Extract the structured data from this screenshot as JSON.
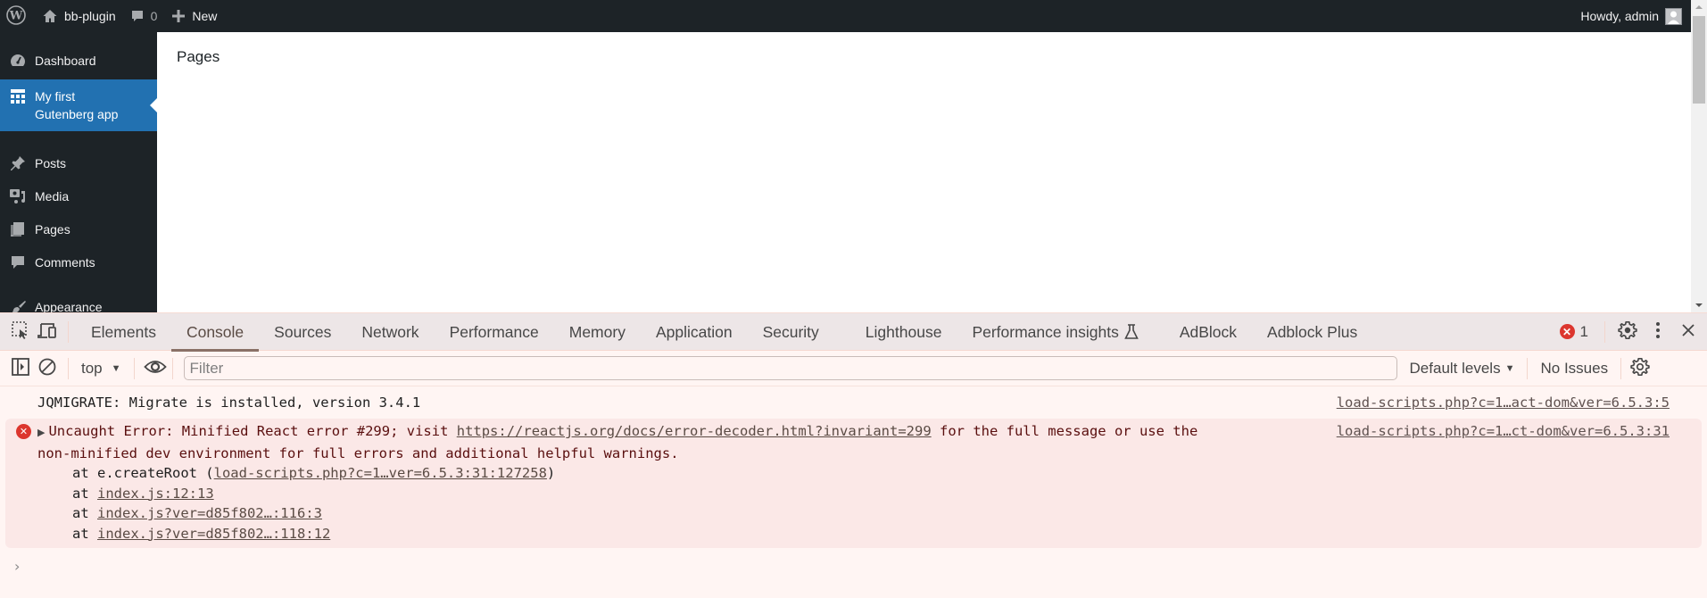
{
  "adminbar": {
    "site_name": "bb-plugin",
    "comments_count": "0",
    "new_label": "New",
    "greeting": "Howdy, admin"
  },
  "sidebar": {
    "items": [
      {
        "label": "Dashboard",
        "icon": "dashboard-icon"
      },
      {
        "label": "My first Gutenberg app",
        "icon": "table-layout-icon",
        "active": true
      },
      {
        "label": "Posts",
        "icon": "pin-icon"
      },
      {
        "label": "Media",
        "icon": "media-icon"
      },
      {
        "label": "Pages",
        "icon": "pages-icon"
      },
      {
        "label": "Comments",
        "icon": "comment-icon"
      },
      {
        "label": "Appearance",
        "icon": "paintbrush-icon"
      }
    ]
  },
  "content": {
    "heading": "Pages"
  },
  "devtools": {
    "tabs": [
      {
        "label": "Elements"
      },
      {
        "label": "Console",
        "selected": true
      },
      {
        "label": "Sources"
      },
      {
        "label": "Network"
      },
      {
        "label": "Performance"
      },
      {
        "label": "Memory"
      },
      {
        "label": "Application"
      },
      {
        "label": "Security"
      },
      {
        "label": "Lighthouse"
      },
      {
        "label": "Performance insights"
      },
      {
        "label": "AdBlock"
      },
      {
        "label": "Adblock Plus"
      }
    ],
    "error_count": "1",
    "toolbar": {
      "context": "top",
      "filter_placeholder": "Filter",
      "levels": "Default levels",
      "issues": "No Issues"
    },
    "console": {
      "log": {
        "text": "JQMIGRATE: Migrate is installed, version 3.4.1",
        "source": "load-scripts.php?c=1…act-dom&ver=6.5.3:5"
      },
      "error": {
        "prefix": "Uncaught Error: Minified React error #299; visit ",
        "url": "https://reactjs.org/docs/error-decoder.html?invariant=299",
        "suffix": " for the full message or use the",
        "line2": "non-minified dev environment for full errors and additional helpful warnings.",
        "source": "load-scripts.php?c=1…ct-dom&ver=6.5.3:31",
        "stack": [
          {
            "prefix": "at e.createRoot (",
            "link": "load-scripts.php?c=1…ver=6.5.3:31:127258",
            "suffix": ")"
          },
          {
            "prefix": "at ",
            "link": "index.js:12:13",
            "suffix": ""
          },
          {
            "prefix": "at ",
            "link": "index.js?ver=d85f802…:116:3",
            "suffix": ""
          },
          {
            "prefix": "at ",
            "link": "index.js?ver=d85f802…:118:12",
            "suffix": ""
          }
        ]
      }
    }
  }
}
